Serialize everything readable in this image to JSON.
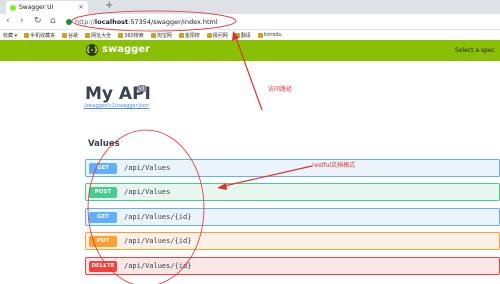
{
  "browser": {
    "tab_title": "Swagger UI",
    "tab_close": "×",
    "new_tab": "+",
    "back": "‹",
    "forward": "›",
    "reload": "↻",
    "home": "⌂",
    "url_protocol": "http://",
    "url_host": "localhost",
    "url_rest": ":57354/swagger/index.html",
    "bookmarks": [
      {
        "label": "收藏 ▾"
      },
      {
        "label": "手机收藏夹"
      },
      {
        "label": "谷歌"
      },
      {
        "label": "网址大全"
      },
      {
        "label": "360搜索"
      },
      {
        "label": "淘宝网"
      },
      {
        "label": "金阳搜"
      },
      {
        "label": "极问网"
      },
      {
        "label": "翻译"
      },
      {
        "label": "Introdu"
      }
    ]
  },
  "swagger": {
    "logo_glyph": "{-}",
    "name": "swagger",
    "select_spec": "Select a spec",
    "accent": "#89bf04"
  },
  "info": {
    "title": "My API",
    "version": "v1",
    "spec_url": "/swagger/v1/swagger.json"
  },
  "group": {
    "name": "Values",
    "operations": [
      {
        "method": "GET",
        "path": "/api/Values",
        "color": "#61affe"
      },
      {
        "method": "POST",
        "path": "/api/Values",
        "color": "#49cc90"
      },
      {
        "method": "GET",
        "path": "/api/Values/{id}",
        "color": "#61affe"
      },
      {
        "method": "PUT",
        "path": "/api/Values/{id}",
        "color": "#fca130"
      },
      {
        "method": "DELETE",
        "path": "/api/Values/{id}",
        "color": "#f93e3e"
      }
    ]
  },
  "annotations": {
    "url_note": "访问路径",
    "format_note": "restful文档格式",
    "color": "#e0322c"
  }
}
